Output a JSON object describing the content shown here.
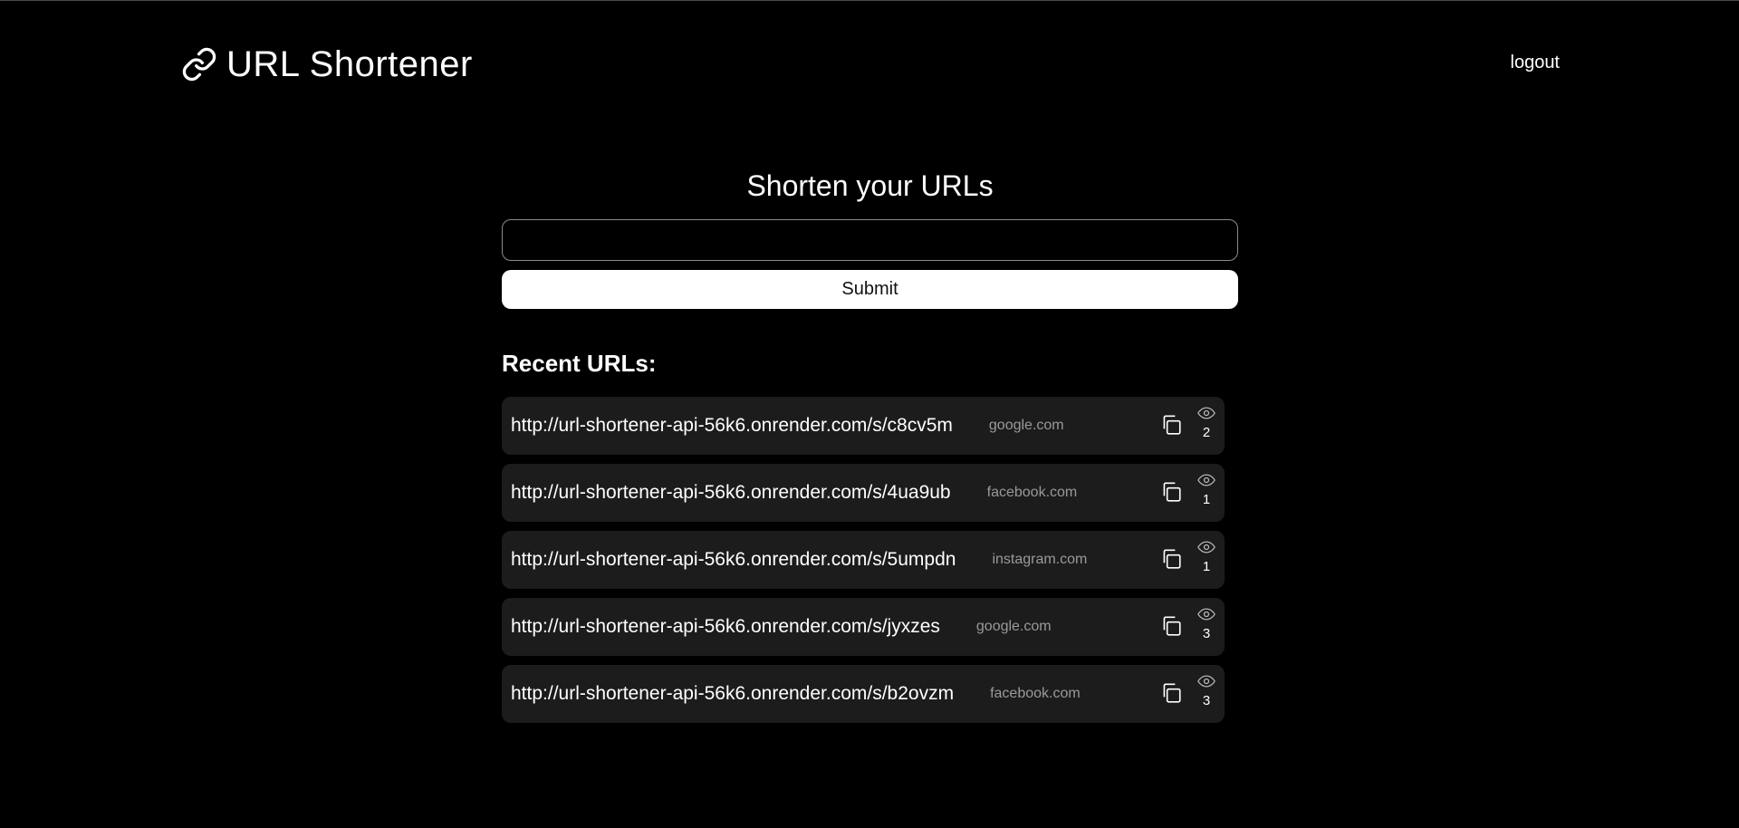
{
  "app": {
    "title": "URL Shortener",
    "logo_icon": "link-icon"
  },
  "header": {
    "logout_label": "logout"
  },
  "form": {
    "heading": "Shorten your URLs",
    "input_value": "",
    "input_placeholder": "",
    "submit_label": "Submit"
  },
  "recent": {
    "heading": "Recent URLs:",
    "items": [
      {
        "short_url": "http://url-shortener-api-56k6.onrender.com/s/c8cv5m",
        "domain": "google.com",
        "views": "2"
      },
      {
        "short_url": "http://url-shortener-api-56k6.onrender.com/s/4ua9ub",
        "domain": "facebook.com",
        "views": "1"
      },
      {
        "short_url": "http://url-shortener-api-56k6.onrender.com/s/5umpdn",
        "domain": "instagram.com",
        "views": "1"
      },
      {
        "short_url": "http://url-shortener-api-56k6.onrender.com/s/jyxzes",
        "domain": "google.com",
        "views": "3"
      },
      {
        "short_url": "http://url-shortener-api-56k6.onrender.com/s/b2ovzm",
        "domain": "facebook.com",
        "views": "3"
      }
    ]
  },
  "colors": {
    "background": "#000000",
    "card": "#1c1c1c",
    "text": "#ffffff",
    "muted": "#9a9a9a",
    "input_border": "#8a8a8a"
  },
  "icons": {
    "copy": "copy-icon",
    "views": "eye-icon"
  }
}
